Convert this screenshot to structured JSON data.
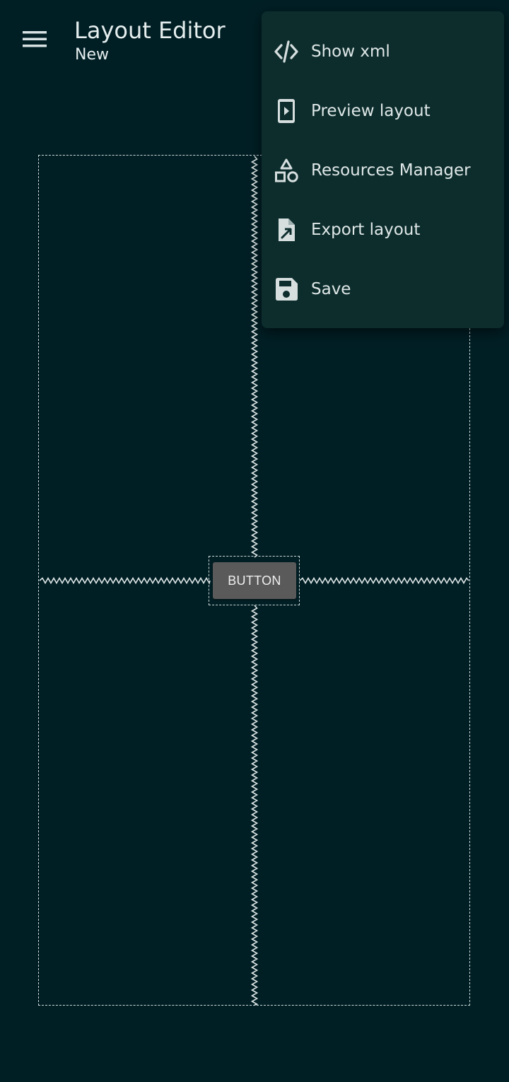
{
  "toolbar": {
    "title": "Layout Editor",
    "subtitle": "New",
    "menu_icon": "hamburger-menu-icon"
  },
  "canvas": {
    "button_text": "BUTTON"
  },
  "overflow_menu": {
    "items": [
      {
        "label": "Show xml",
        "icon": "code-icon"
      },
      {
        "label": "Preview layout",
        "icon": "phone-preview-icon"
      },
      {
        "label": "Resources Manager",
        "icon": "shapes-icon"
      },
      {
        "label": "Export layout",
        "icon": "file-export-icon"
      },
      {
        "label": "Save",
        "icon": "floppy-save-icon"
      }
    ]
  },
  "colors": {
    "background": "#001f25",
    "menu_background": "#0d2d2d",
    "text": "#e6eeee",
    "button": "#5a5a5a"
  }
}
